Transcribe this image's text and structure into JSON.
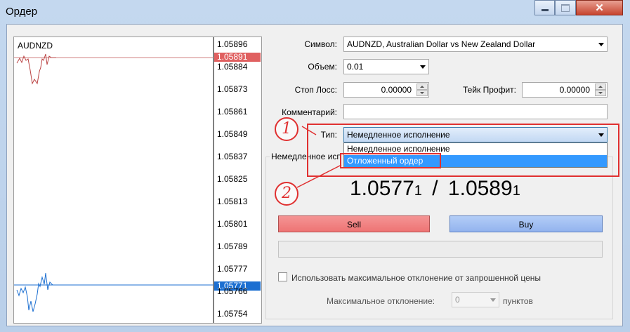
{
  "window": {
    "title": "Ордер"
  },
  "chart": {
    "symbol": "AUDNZD",
    "price_labels": [
      "1.05896",
      "1.05884",
      "1.05873",
      "1.05861",
      "1.05849",
      "1.05837",
      "1.05825",
      "1.05813",
      "1.05801",
      "1.05789",
      "1.05777",
      "1.05766",
      "1.05754"
    ],
    "ask_marker": "1.05891",
    "bid_marker": "1.05771",
    "ask_color": "#e06060",
    "bid_color": "#1c6fd1"
  },
  "form": {
    "symbol_label": "Символ:",
    "symbol_value": "AUDNZD, Australian Dollar vs New Zealand Dollar",
    "volume_label": "Объем:",
    "volume_value": "0.01",
    "sl_label": "Стоп Лосс:",
    "sl_value": "0.00000",
    "tp_label": "Тейк Профит:",
    "tp_value": "0.00000",
    "comment_label": "Комментарий:",
    "comment_value": "",
    "type_label": "Тип:",
    "type_value": "Немедленное исполнение",
    "type_options": [
      "Немедленное исполнение",
      "Отложенный ордер"
    ],
    "group_label": "Немедленное исп",
    "bid_price_main": "1.0577",
    "bid_price_sub": "1",
    "separator": "/",
    "ask_price_main": "1.0589",
    "ask_price_sub": "1",
    "sell_label": "Sell",
    "buy_label": "Buy",
    "max_dev_checkbox_label": "Использовать максимальное отклонение от запрошенной цены",
    "max_dev_label": "Максимальное отклонение:",
    "max_dev_value": "0",
    "points_label": "пунктов"
  },
  "annotations": {
    "callout_1": "1",
    "callout_2": "2",
    "color": "#e03030"
  }
}
